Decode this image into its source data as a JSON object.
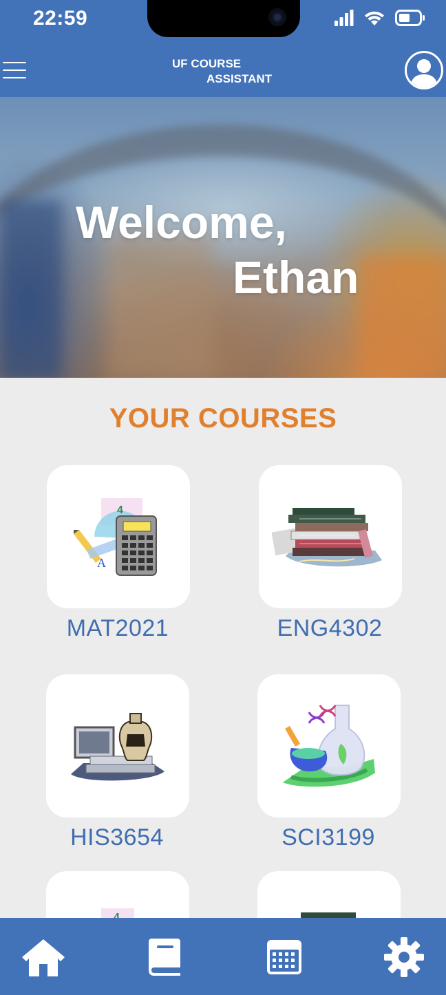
{
  "status_bar": {
    "time": "22:59",
    "icons": [
      "signal-icon",
      "wifi-icon",
      "battery-icon"
    ]
  },
  "header": {
    "title_line1": "UF COURSE",
    "title_line2": "ASSISTANT",
    "menu_icon": "hamburger-menu-icon",
    "profile_icon": "user-avatar-icon"
  },
  "hero": {
    "greeting": "Welcome,",
    "name": "Ethan"
  },
  "courses": {
    "heading": "YOUR COURSES",
    "items": [
      {
        "code": "MAT2021",
        "icon": "math-tools-icon"
      },
      {
        "code": "ENG4302",
        "icon": "book-stack-icon"
      },
      {
        "code": "HIS3654",
        "icon": "history-artifacts-icon"
      },
      {
        "code": "SCI3199",
        "icon": "science-lab-icon"
      }
    ]
  },
  "bottom_nav": {
    "items": [
      "home-icon",
      "book-icon",
      "calendar-icon",
      "settings-icon"
    ]
  },
  "colors": {
    "primary_blue": "#4272b8",
    "accent_orange": "#e0802e",
    "label_blue": "#3f6db0",
    "background": "#ececec"
  }
}
